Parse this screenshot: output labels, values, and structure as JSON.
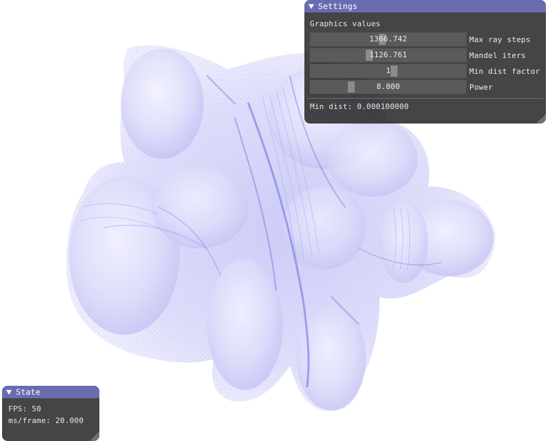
{
  "settings": {
    "title": "Settings",
    "section_label": "Graphics values",
    "sliders": [
      {
        "label": "Max ray steps",
        "value": "1366.742",
        "fraction": 0.46
      },
      {
        "label": "Mandel iters",
        "value": "1126.761",
        "fraction": 0.37
      },
      {
        "label": "Min dist factor",
        "value": "1",
        "fraction": 0.54
      },
      {
        "label": "Power",
        "value": "8.000",
        "fraction": 0.25
      }
    ],
    "min_dist_text": "Min dist: 0.000100000"
  },
  "state": {
    "title": "State",
    "fps_text": "FPS: 50",
    "ms_frame_text": "ms/frame: 20.000"
  },
  "colors": {
    "title_bar": "#6a6cb0",
    "window_bg": "#262626",
    "slider_bg": "#5a5a5a",
    "slider_grab": "#8c8c8c",
    "fractal_tint": "#8c8cf0"
  }
}
